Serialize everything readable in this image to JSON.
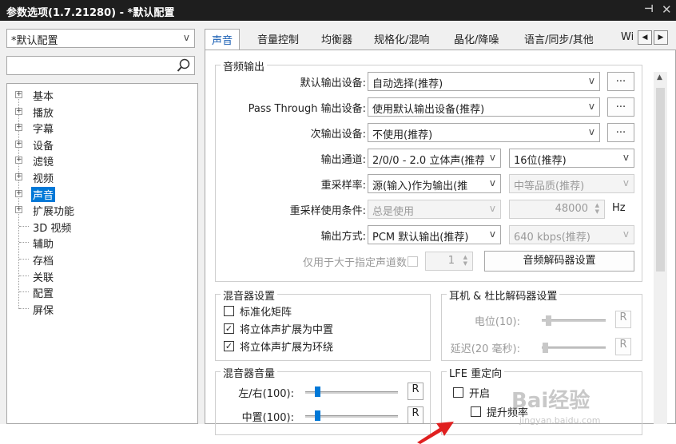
{
  "window": {
    "title": "参数选项(1.7.21280) - *默认配置"
  },
  "profile": {
    "selected": "*默认配置"
  },
  "search": {
    "value": ""
  },
  "tree": {
    "items": [
      {
        "label": "基本",
        "expandable": true
      },
      {
        "label": "播放",
        "expandable": true
      },
      {
        "label": "字幕",
        "expandable": true
      },
      {
        "label": "设备",
        "expandable": true
      },
      {
        "label": "滤镜",
        "expandable": true
      },
      {
        "label": "视频",
        "expandable": true
      },
      {
        "label": "声音",
        "expandable": true,
        "selected": true
      },
      {
        "label": "扩展功能",
        "expandable": true
      },
      {
        "label": "3D 视频",
        "expandable": false
      },
      {
        "label": "辅助",
        "expandable": false
      },
      {
        "label": "存档",
        "expandable": false
      },
      {
        "label": "关联",
        "expandable": false
      },
      {
        "label": "配置",
        "expandable": false
      },
      {
        "label": "屏保",
        "expandable": false
      }
    ]
  },
  "tabs": [
    "声音",
    "音量控制",
    "均衡器",
    "规格化/混响",
    "晶化/降噪",
    "语言/同步/其他",
    "Wi"
  ],
  "audio_output": {
    "title": "音频输出",
    "default_device_label": "默认输出设备:",
    "default_device_value": "自动选择(推荐)",
    "passthrough_label": "Pass Through 输出设备:",
    "passthrough_value": "使用默认输出设备(推荐)",
    "secondary_label": "次输出设备:",
    "secondary_value": "不使用(推荐)",
    "more_label": "...",
    "channel_label": "输出通道:",
    "channel_value": "2/0/0 - 2.0 立体声(推荐",
    "bits_value": "16位(推荐)",
    "resample_label": "重采样率:",
    "resample_value": "源(输入)作为输出(推",
    "quality_value": "中等品质(推荐)",
    "resample_cond_label": "重采样使用条件:",
    "resample_cond_value": "总是使用",
    "hz_value": "48000",
    "hz_unit": "Hz",
    "output_method_label": "输出方式:",
    "output_method_value": "PCM 默认输出(推荐)",
    "bitrate_value": "640 kbps(推荐)",
    "channels_only_label": "仅用于大于指定声道数",
    "channels_value": "1",
    "decoder_button": "音频解码器设置"
  },
  "mixer": {
    "title": "混音器设置",
    "items": [
      {
        "label": "标准化矩阵",
        "checked": false
      },
      {
        "label": "将立体声扩展为中置",
        "checked": true
      },
      {
        "label": "将立体声扩展为环绕",
        "checked": true
      }
    ]
  },
  "headphone": {
    "title": "耳机 & 杜比解码器设置",
    "level_label": "电位(10):",
    "delay_label": "延迟(20 毫秒):",
    "reset_label": "R"
  },
  "mixer_volume": {
    "title": "混音器音量",
    "lr_label": "左/右(100):",
    "center_label": "中置(100):",
    "lr_level": 0.1,
    "center_level": 0.1,
    "reset_label": "R"
  },
  "lfe": {
    "title": "LFE 重定向",
    "enable_label": "开启",
    "boost_label": "提升频率"
  },
  "watermark": {
    "text": "Bai经验",
    "sub": "jingyan.baidu.com"
  }
}
